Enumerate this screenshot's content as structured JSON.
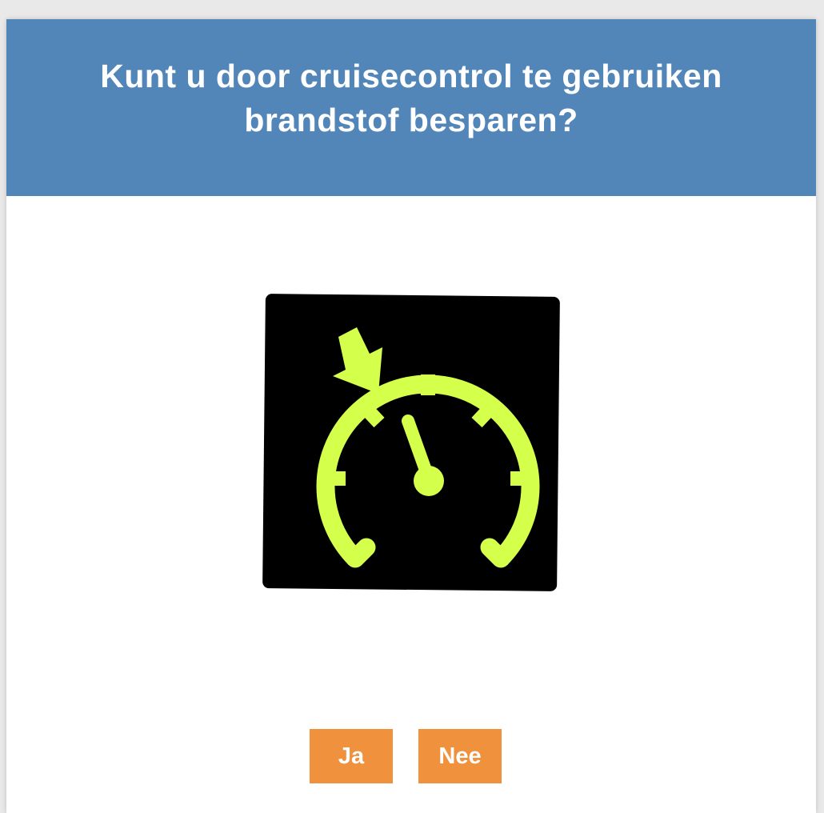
{
  "question": {
    "text": "Kunt u door cruisecontrol te gebruiken brandstof besparen?"
  },
  "image": {
    "icon": "cruise-control-speedometer-icon",
    "background_color": "#000000",
    "icon_color": "#d4ff4a"
  },
  "answers": {
    "yes_label": "Ja",
    "no_label": "Nee"
  },
  "colors": {
    "header": "#5286b8",
    "button": "#f0923d",
    "text": "#ffffff"
  }
}
